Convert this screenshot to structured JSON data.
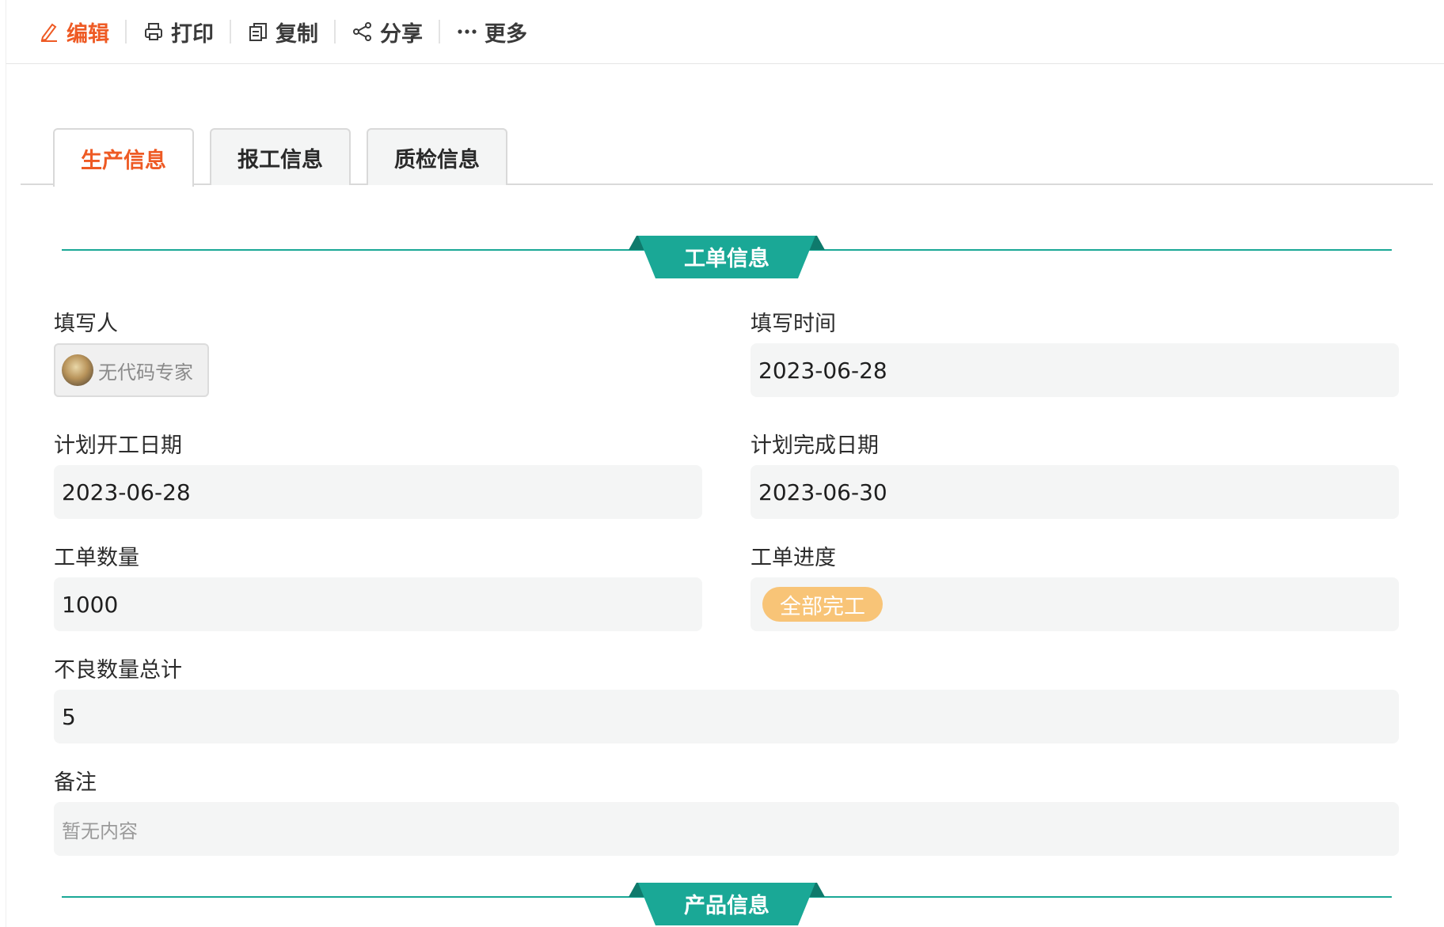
{
  "toolbar": {
    "edit": "编辑",
    "print": "打印",
    "copy": "复制",
    "share": "分享",
    "more": "更多"
  },
  "tabs": [
    {
      "label": "生产信息",
      "active": true
    },
    {
      "label": "报工信息",
      "active": false
    },
    {
      "label": "质检信息",
      "active": false
    }
  ],
  "sections": {
    "work_order": "工单信息",
    "product": "产品信息"
  },
  "fields": {
    "filler": {
      "label": "填写人",
      "value": "无代码专家"
    },
    "fill_time": {
      "label": "填写时间",
      "value": "2023-06-28"
    },
    "plan_start": {
      "label": "计划开工日期",
      "value": "2023-06-28"
    },
    "plan_finish": {
      "label": "计划完成日期",
      "value": "2023-06-30"
    },
    "quantity": {
      "label": "工单数量",
      "value": "1000"
    },
    "progress": {
      "label": "工单进度",
      "value": "全部完工"
    },
    "defects": {
      "label": "不良数量总计",
      "value": "5"
    },
    "remark": {
      "label": "备注",
      "placeholder": "暂无内容"
    }
  },
  "colors": {
    "accent": "#ee5a24",
    "teal": "#1aa896",
    "badge": "#f8c477",
    "field_bg": "#f4f5f5"
  }
}
